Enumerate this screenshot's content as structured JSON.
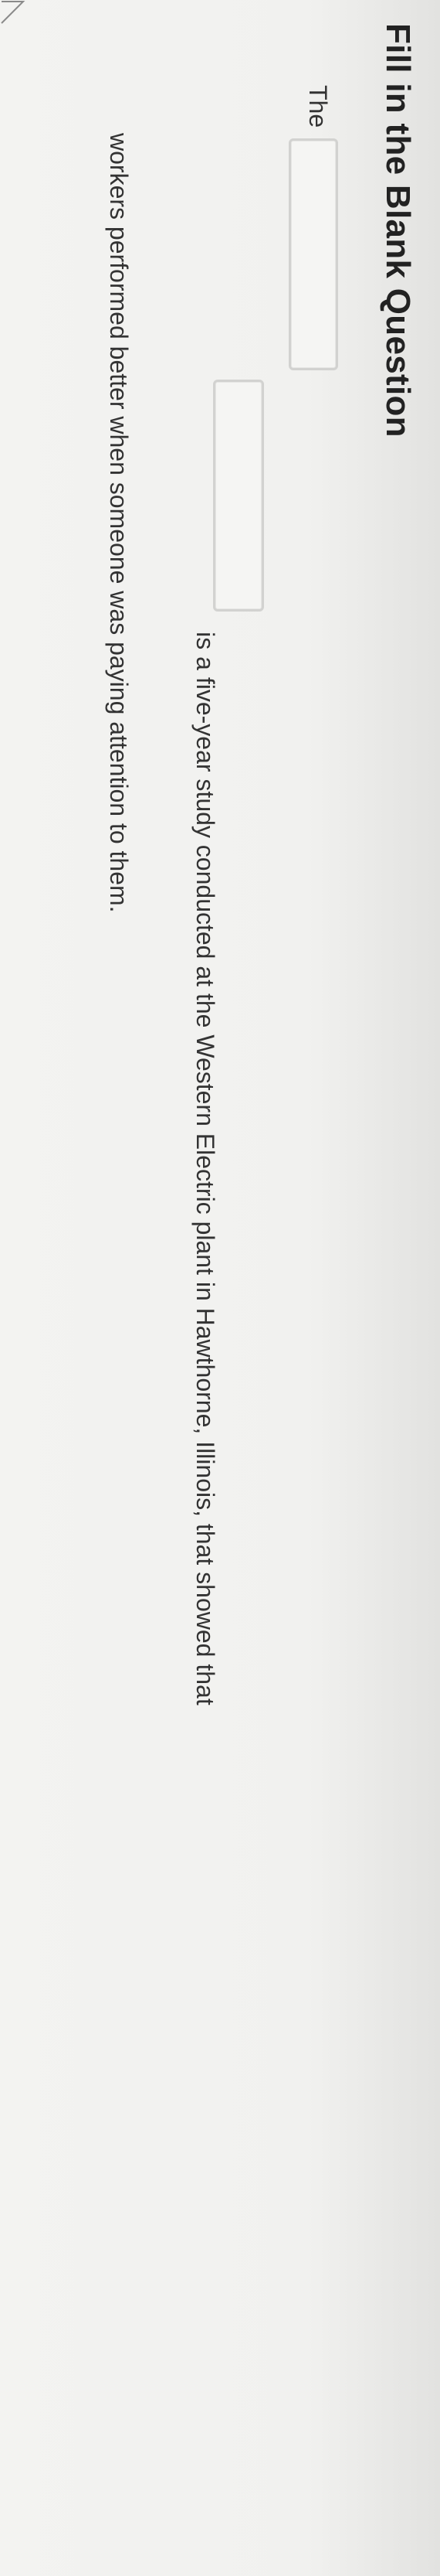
{
  "question": {
    "title": "Fill in the Blank Question",
    "text_before": "The",
    "text_after": "is a five-year study conducted at the Western Electric plant in Hawthorne, Illinois, that showed that",
    "text_continuation": "workers performed better when someone was paying attention to them.",
    "blanks": [
      {
        "value": ""
      },
      {
        "value": ""
      }
    ]
  }
}
